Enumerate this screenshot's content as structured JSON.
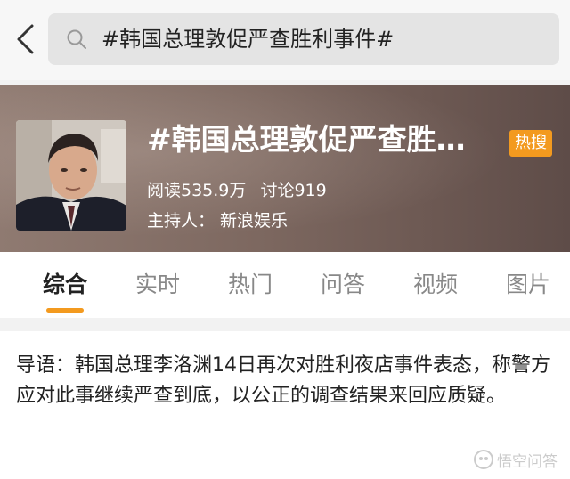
{
  "search": {
    "query": "#韩国总理敦促严查胜利事件#",
    "back_icon": "back-arrow-icon",
    "search_icon": "search-icon"
  },
  "topic": {
    "title": "#韩国总理敦促严查胜利事件#",
    "badge": "热搜",
    "reads": "阅读535.9万",
    "discussions": "讨论919",
    "host": "主持人：  新浪娱乐",
    "colors": {
      "badge": "#f39a1f"
    }
  },
  "tabs": [
    {
      "label": "综合",
      "active": true
    },
    {
      "label": "实时",
      "active": false
    },
    {
      "label": "热门",
      "active": false
    },
    {
      "label": "问答",
      "active": false
    },
    {
      "label": "视频",
      "active": false
    },
    {
      "label": "图片",
      "active": false
    }
  ],
  "content": {
    "intro": "导语：韩国总理李洛渊14日再次对胜利夜店事件表态，称警方应对此事继续严查到底，以公正的调查结果来回应质疑。"
  },
  "watermark": {
    "text": "悟空问答"
  },
  "colors": {
    "accent": "#f39a1f",
    "banner": "#7d6860"
  }
}
